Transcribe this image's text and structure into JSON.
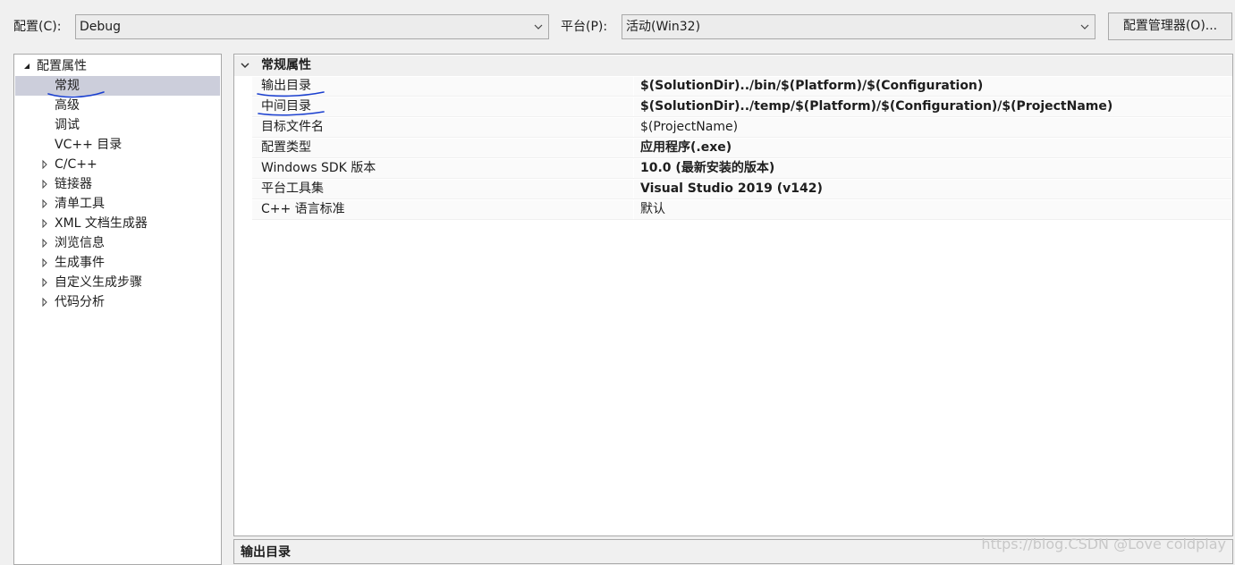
{
  "toolbar": {
    "config_label": "配置(C):",
    "config_value": "Debug",
    "platform_label": "平台(P):",
    "platform_value": "活动(Win32)",
    "config_manager_button": "配置管理器(O)..."
  },
  "tree": {
    "root": "配置属性",
    "items": [
      {
        "label": "常规",
        "selected": true
      },
      {
        "label": "高级"
      },
      {
        "label": "调试"
      },
      {
        "label": "VC++ 目录"
      },
      {
        "label": "C/C++"
      },
      {
        "label": "链接器"
      },
      {
        "label": "清单工具"
      },
      {
        "label": "XML 文档生成器"
      },
      {
        "label": "浏览信息"
      },
      {
        "label": "生成事件"
      },
      {
        "label": "自定义生成步骤"
      },
      {
        "label": "代码分析"
      }
    ]
  },
  "grid": {
    "section": "常规属性",
    "rows": [
      {
        "name": "输出目录",
        "value": "$(SolutionDir)../bin/$(Platform)/$(Configuration)"
      },
      {
        "name": "中间目录",
        "value": "$(SolutionDir)../temp/$(Platform)/$(Configuration)/$(ProjectName)"
      },
      {
        "name": "目标文件名",
        "value": "$(ProjectName)"
      },
      {
        "name": "配置类型",
        "value": "应用程序(.exe)"
      },
      {
        "name": "Windows SDK 版本",
        "value": "10.0 (最新安装的版本)"
      },
      {
        "name": "平台工具集",
        "value": "Visual Studio 2019 (v142)"
      },
      {
        "name": "C++ 语言标准",
        "value": "默认"
      }
    ]
  },
  "description": {
    "title": "输出目录"
  },
  "watermark": "https://blog.CSDN @Love coldplay",
  "colors": {
    "annotation_ink": "#1a3fcf",
    "selection": "#cccedb"
  }
}
